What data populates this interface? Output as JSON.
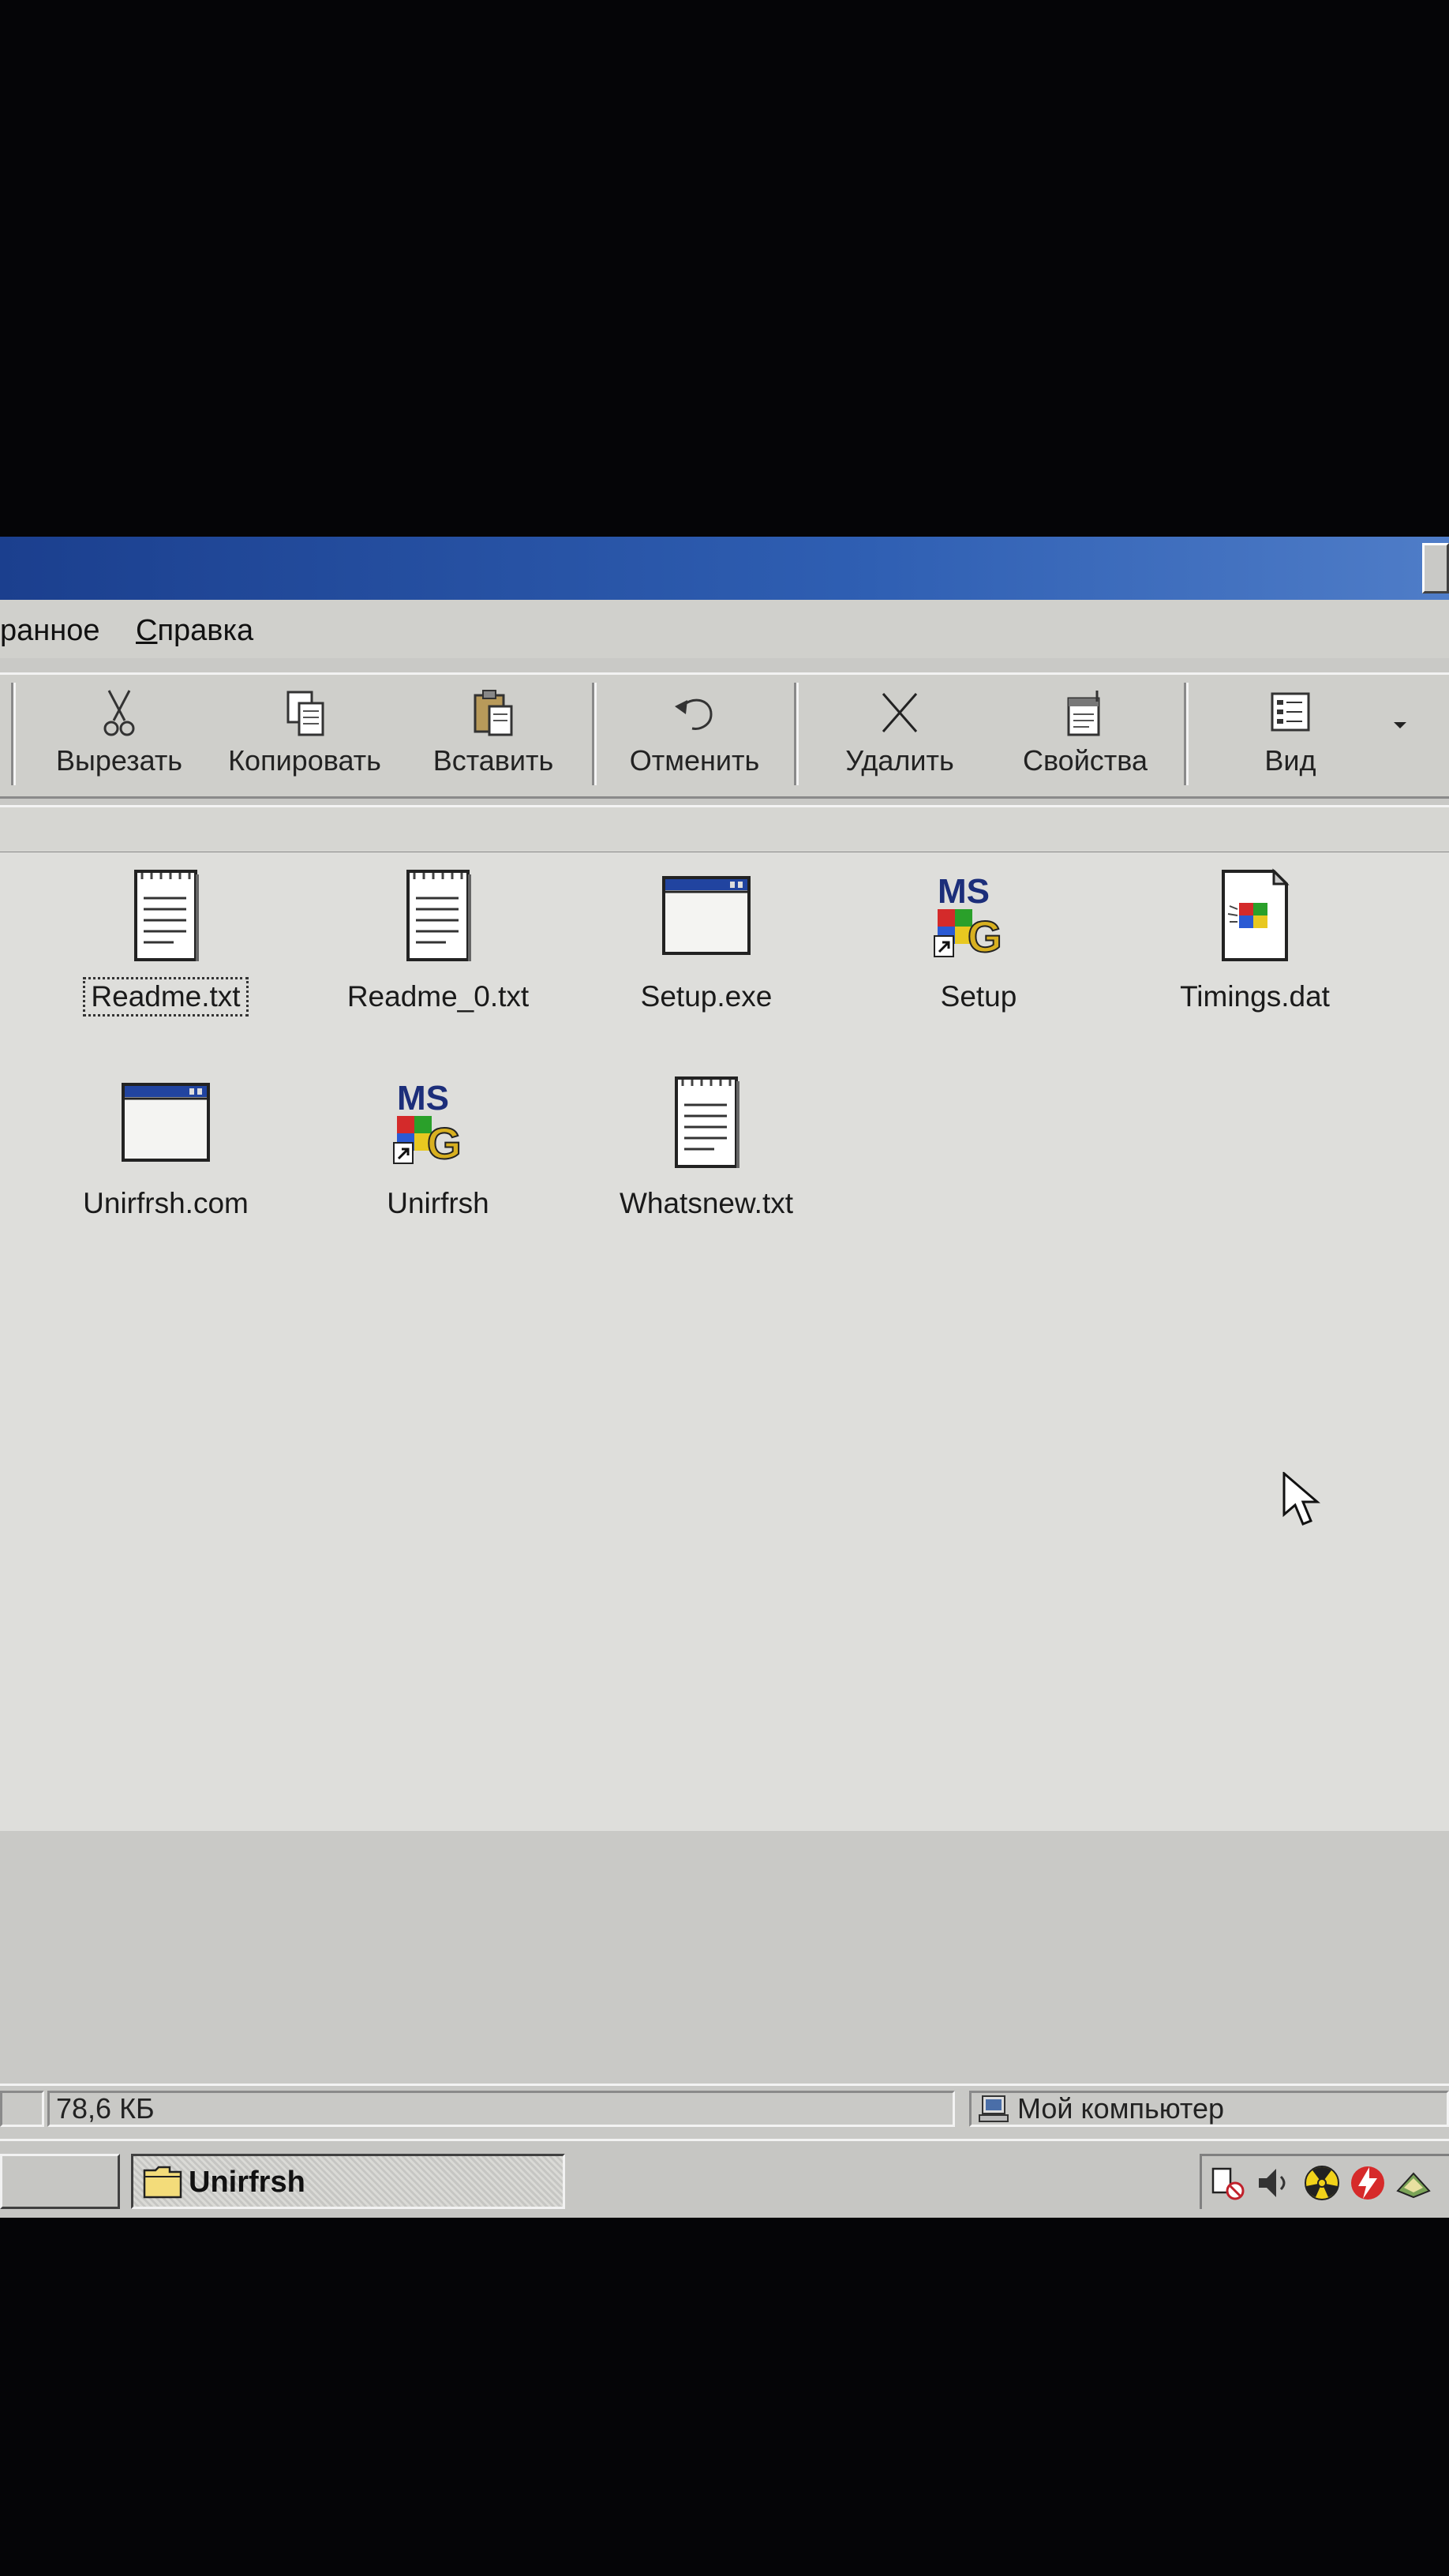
{
  "menu": {
    "favorites_partial": "ранное",
    "help_first_letter": "С",
    "help_rest": "правка"
  },
  "toolbar": {
    "cut_label": "Вырезать",
    "copy_label": "Копировать",
    "paste_label": "Вставить",
    "undo_label": "Отменить",
    "delete_label": "Удалить",
    "properties_label": "Свойства",
    "view_label": "Вид"
  },
  "files": [
    {
      "name": "Readme.txt",
      "icon": "text-document-icon",
      "selected": true
    },
    {
      "name": "Readme_0.txt",
      "icon": "text-document-icon",
      "selected": false
    },
    {
      "name": "Setup.exe",
      "icon": "application-window-icon",
      "selected": false
    },
    {
      "name": "Setup",
      "icon": "msdos-shortcut-icon",
      "selected": false
    },
    {
      "name": "Timings.dat",
      "icon": "unknown-file-icon",
      "selected": false
    },
    {
      "name": "Unirfrsh.com",
      "icon": "application-window-icon",
      "selected": false
    },
    {
      "name": "Unirfrsh",
      "icon": "msdos-shortcut-icon",
      "selected": false
    },
    {
      "name": "Whatsnew.txt",
      "icon": "text-document-icon",
      "selected": false
    }
  ],
  "status": {
    "size": "78,6 КБ",
    "location": "Мой компьютер"
  },
  "taskbar": {
    "active_window": "Unirfrsh"
  },
  "colors": {
    "titlebar": "#1b3f8e",
    "window_bg": "#c9c9c6",
    "content_bg": "#dededb"
  }
}
